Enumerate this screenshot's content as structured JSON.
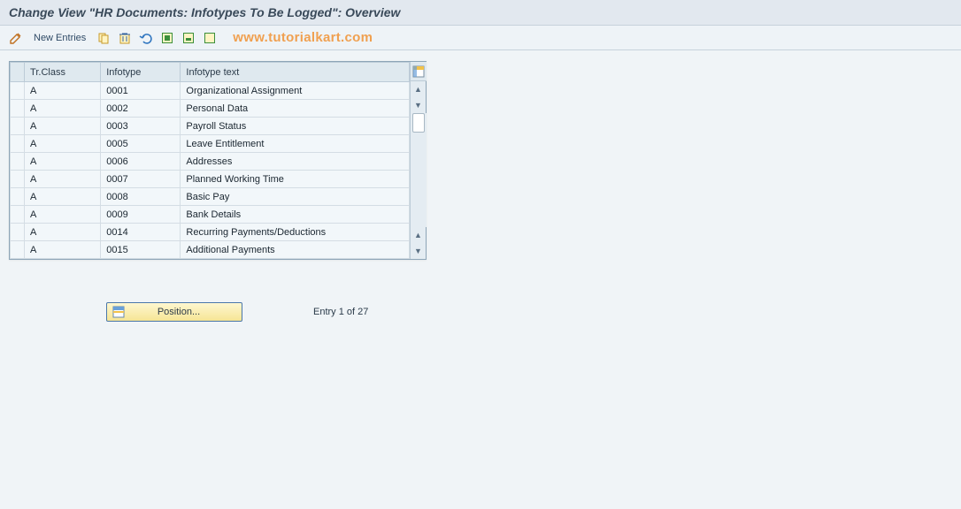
{
  "header": {
    "title": "Change View \"HR Documents: Infotypes To Be Logged\": Overview"
  },
  "toolbar": {
    "new_entries": "New Entries",
    "watermark": "www.tutorialkart.com"
  },
  "table": {
    "headers": {
      "tr_class": "Tr.Class",
      "infotype": "Infotype",
      "infotype_text": "Infotype text"
    },
    "rows": [
      {
        "tr_class": "A",
        "infotype": "0001",
        "text": "Organizational Assignment"
      },
      {
        "tr_class": "A",
        "infotype": "0002",
        "text": "Personal Data"
      },
      {
        "tr_class": "A",
        "infotype": "0003",
        "text": "Payroll Status"
      },
      {
        "tr_class": "A",
        "infotype": "0005",
        "text": "Leave Entitlement"
      },
      {
        "tr_class": "A",
        "infotype": "0006",
        "text": "Addresses"
      },
      {
        "tr_class": "A",
        "infotype": "0007",
        "text": "Planned Working Time"
      },
      {
        "tr_class": "A",
        "infotype": "0008",
        "text": "Basic Pay"
      },
      {
        "tr_class": "A",
        "infotype": "0009",
        "text": "Bank Details"
      },
      {
        "tr_class": "A",
        "infotype": "0014",
        "text": "Recurring Payments/Deductions"
      },
      {
        "tr_class": "A",
        "infotype": "0015",
        "text": "Additional Payments"
      }
    ]
  },
  "footer": {
    "position_label": "Position...",
    "entry_info": "Entry 1 of 27"
  }
}
